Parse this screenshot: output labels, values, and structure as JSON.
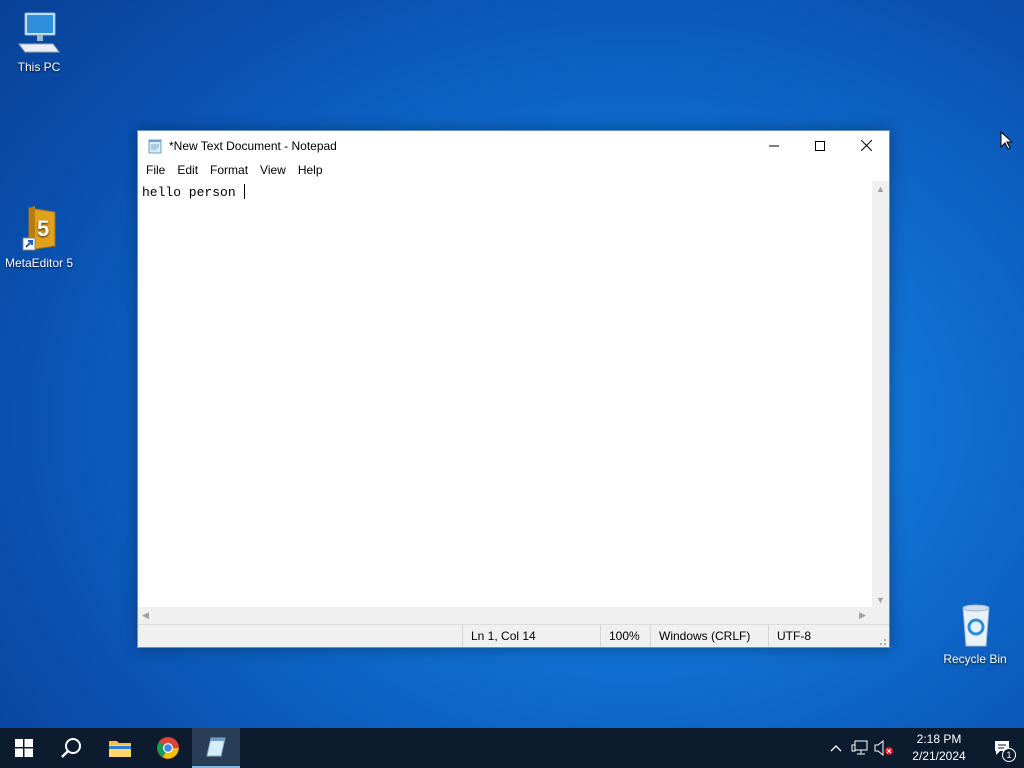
{
  "desktop": {
    "icons": [
      {
        "label": "This PC"
      },
      {
        "label": "MetaEditor 5"
      },
      {
        "label": "Recycle Bin"
      }
    ]
  },
  "notepad": {
    "title": "*New Text Document - Notepad",
    "menu": [
      "File",
      "Edit",
      "Format",
      "View",
      "Help"
    ],
    "content": "hello person ",
    "status": {
      "position": "Ln 1, Col 14",
      "zoom": "100%",
      "line_ending": "Windows (CRLF)",
      "encoding": "UTF-8"
    }
  },
  "taskbar": {
    "time": "2:18 PM",
    "date": "2/21/2024",
    "notification_count": "1"
  },
  "colors": {
    "desktop_blue": "#0f6fd0",
    "taskbar_bg": "#0d1b2e",
    "accent": "#76b9ed"
  }
}
